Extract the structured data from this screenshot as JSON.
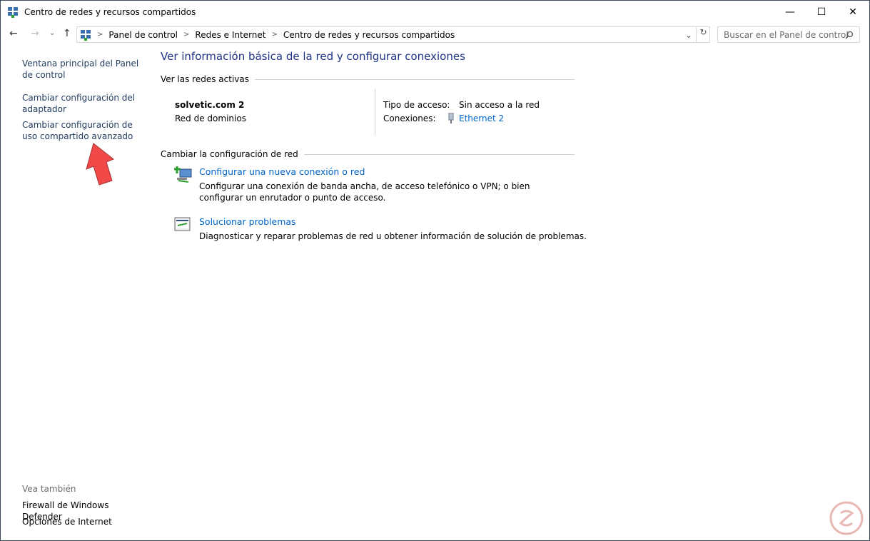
{
  "window": {
    "title": "Centro de redes y recursos compartidos",
    "minimize": "—",
    "maximize": "☐",
    "close": "✕"
  },
  "nav": {
    "back": "←",
    "forward": "→",
    "recent": "⌄",
    "up": "↑",
    "refresh": "↻",
    "dropdown": "⌄",
    "breadcrumb": [
      "Panel de control",
      "Redes e Internet",
      "Centro de redes y recursos compartidos"
    ],
    "search_placeholder": "Buscar en el Panel de control"
  },
  "sidebar": {
    "links": [
      "Ventana principal del Panel de control",
      "Cambiar configuración del adaptador",
      "Cambiar configuración de uso compartido avanzado"
    ],
    "see_also_title": "Vea también",
    "see_also": [
      "Firewall de Windows Defender",
      "Opciones de Internet"
    ]
  },
  "main": {
    "title": "Ver información básica de la red y configurar conexiones",
    "active_section": "Ver las redes activas",
    "network": {
      "name": "solvetic.com 2",
      "type": "Red de dominios",
      "access_label": "Tipo de acceso:",
      "access_value": "Sin acceso a la red",
      "connections_label": "Conexiones:",
      "connection": "Ethernet 2"
    },
    "change_section": "Cambiar la configuración de red",
    "tasks": [
      {
        "title": "Configurar una nueva conexión o red",
        "desc": "Configurar una conexión de banda ancha, de acceso telefónico o VPN; o bien configurar un enrutador o punto de acceso.",
        "icon": "new-connection-icon"
      },
      {
        "title": "Solucionar problemas",
        "desc": "Diagnosticar y reparar problemas de red u obtener información de solución de problemas.",
        "icon": "troubleshoot-icon"
      }
    ]
  },
  "colors": {
    "heading": "#1e3287",
    "link": "#0066cc",
    "sidebar_link": "#1e395b",
    "arrow": "#f24848"
  }
}
